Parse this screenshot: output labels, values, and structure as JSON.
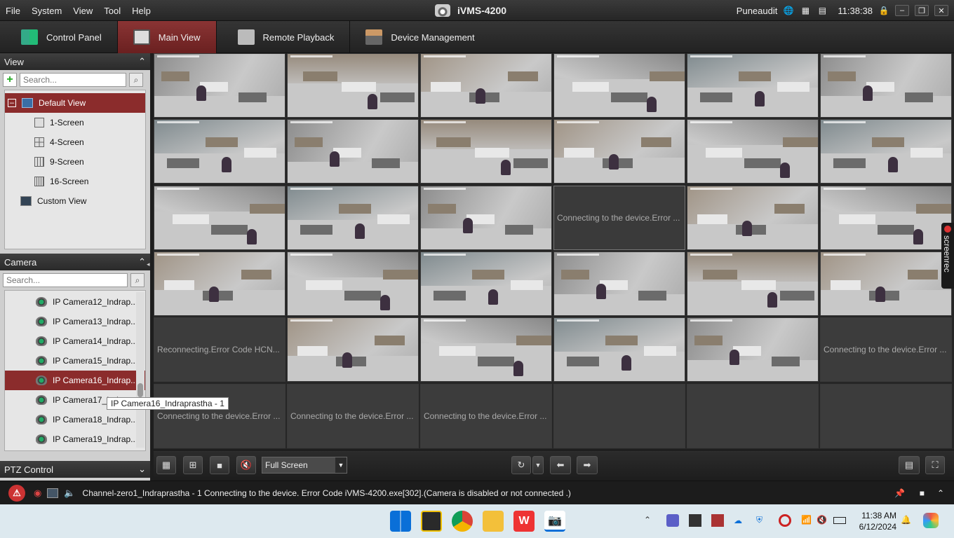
{
  "menu": [
    "File",
    "System",
    "View",
    "Tool",
    "Help"
  ],
  "app_title": "iVMS-4200",
  "user": "Puneaudit",
  "time": "11:38:38",
  "tabs": [
    {
      "label": "Control Panel"
    },
    {
      "label": "Main View"
    },
    {
      "label": "Remote Playback"
    },
    {
      "label": "Device Management"
    }
  ],
  "view_panel": {
    "title": "View",
    "search_placeholder": "Search...",
    "items": [
      "Default View",
      "1-Screen",
      "4-Screen",
      "9-Screen",
      "16-Screen",
      "Custom View"
    ]
  },
  "camera_panel": {
    "title": "Camera",
    "search_placeholder": "Search...",
    "items": [
      "IP Camera12_Indrap...",
      "IP Camera13_Indrap...",
      "IP Camera14_Indrap...",
      "IP Camera15_Indrap...",
      "IP Camera16_Indrap...",
      "IP Camera17_Indrap...",
      "IP Camera18_Indrap...",
      "IP Camera19_Indrap..."
    ],
    "tooltip": "IP Camera16_Indraprastha - 1"
  },
  "ptz_title": "PTZ Control",
  "grid_messages": {
    "connecting": "Connecting to the device.Error ...",
    "reconnecting": "Reconnecting.Error Code HCN...",
    "connecting2": "Connecting to the device.Error ..."
  },
  "screen_mode": "Full Screen",
  "status_message": "Channel-zero1_Indraprastha - 1 Connecting to the device. Error Code iVMS-4200.exe[302].(Camera is disabled or not connected .)",
  "screenrec_label": "screenrec",
  "taskbar": {
    "time": "11:38 AM",
    "date": "6/12/2024"
  },
  "colors": {
    "accent": "#8b2c2c",
    "active_tab": "#7a2a2a"
  }
}
